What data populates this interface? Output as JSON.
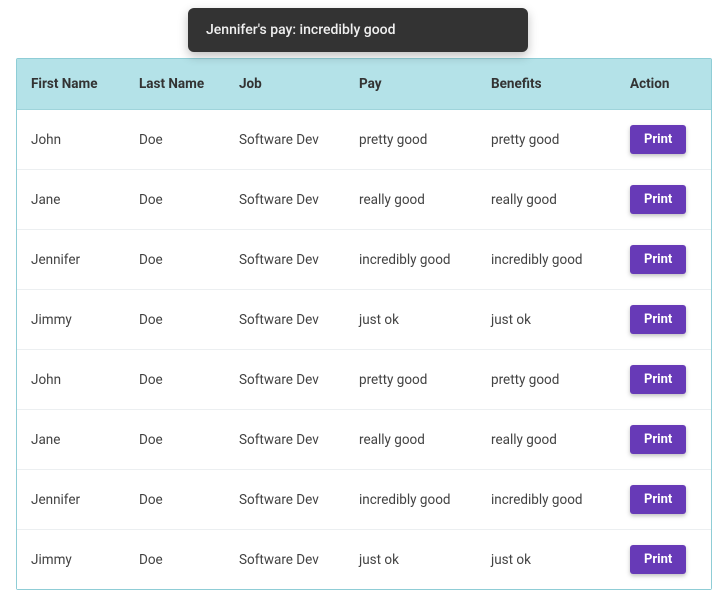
{
  "tooltip": {
    "text": "Jennifer's pay: incredibly good"
  },
  "table": {
    "headers": {
      "first_name": "First Name",
      "last_name": "Last Name",
      "job": "Job",
      "pay": "Pay",
      "benefits": "Benefits",
      "action": "Action"
    },
    "action_label": "Print",
    "rows": [
      {
        "first_name": "John",
        "last_name": "Doe",
        "job": "Software Dev",
        "pay": "pretty good",
        "benefits": "pretty good"
      },
      {
        "first_name": "Jane",
        "last_name": "Doe",
        "job": "Software Dev",
        "pay": "really good",
        "benefits": "really good"
      },
      {
        "first_name": "Jennifer",
        "last_name": "Doe",
        "job": "Software Dev",
        "pay": "incredibly good",
        "benefits": "incredibly good"
      },
      {
        "first_name": "Jimmy",
        "last_name": "Doe",
        "job": "Software Dev",
        "pay": "just ok",
        "benefits": "just ok"
      },
      {
        "first_name": "John",
        "last_name": "Doe",
        "job": "Software Dev",
        "pay": "pretty good",
        "benefits": "pretty good"
      },
      {
        "first_name": "Jane",
        "last_name": "Doe",
        "job": "Software Dev",
        "pay": "really good",
        "benefits": "really good"
      },
      {
        "first_name": "Jennifer",
        "last_name": "Doe",
        "job": "Software Dev",
        "pay": "incredibly good",
        "benefits": "incredibly good"
      },
      {
        "first_name": "Jimmy",
        "last_name": "Doe",
        "job": "Software Dev",
        "pay": "just ok",
        "benefits": "just ok"
      }
    ]
  }
}
